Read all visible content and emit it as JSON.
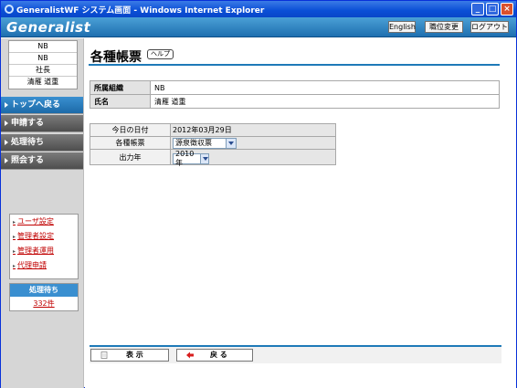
{
  "window": {
    "title": "GeneralistWF システム画面 - Windows Internet Explorer"
  },
  "header": {
    "logo": "Generalist",
    "buttons": {
      "english": "English",
      "change_position": "職位変更",
      "logout": "ログアウト"
    }
  },
  "user": {
    "lines": [
      "NB",
      "NB",
      "社長",
      "清雁 道重"
    ]
  },
  "nav": {
    "items": [
      {
        "label": "トップへ戻る"
      },
      {
        "label": "申請する"
      },
      {
        "label": "処理待ち"
      },
      {
        "label": "照会する"
      }
    ]
  },
  "links": [
    {
      "label": "ユーザ設定"
    },
    {
      "label": "管理者設定"
    },
    {
      "label": "管理者運用"
    },
    {
      "label": "代理申請"
    }
  ],
  "pending": {
    "label": "処理待ち",
    "count": "332件"
  },
  "page": {
    "title": "各種帳票",
    "help": "ヘルプ"
  },
  "info": {
    "org_label": "所属組織",
    "org_value": "NB",
    "name_label": "氏名",
    "name_value": "清雁 道重"
  },
  "form": {
    "date_label": "今日の日付",
    "date_value": "2012年03月29日",
    "report_label": "各種帳票",
    "report_value": "源泉徴収票",
    "year_label": "出力年",
    "year_value": "2010年"
  },
  "buttons": {
    "display": "表 示",
    "back": "戻 る"
  },
  "colors": {
    "accent": "#1e7ab8",
    "link": "#c00000",
    "nav_active": "#3a8fd0"
  }
}
